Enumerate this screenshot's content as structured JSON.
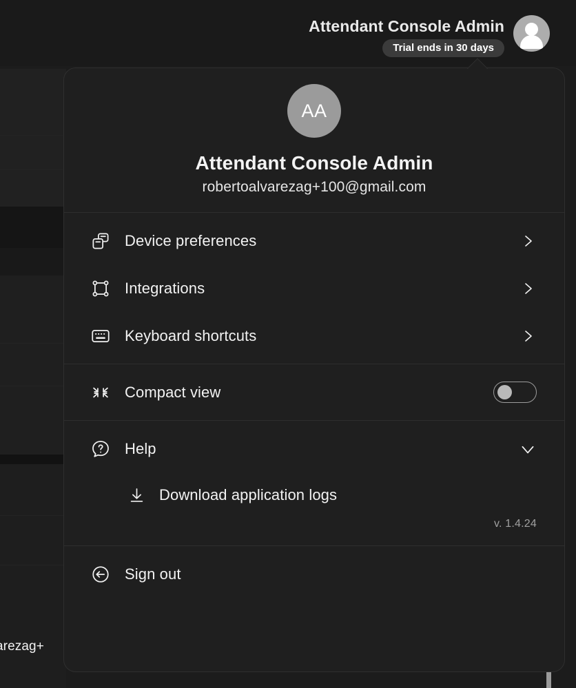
{
  "header": {
    "user_name": "Attendant Console Admin",
    "trial_badge": "Trial ends in 30 days",
    "avatar_icon": "person-avatar-icon"
  },
  "background": {
    "clipped_email_text": "arezag+"
  },
  "popup": {
    "profile": {
      "initials": "AA",
      "name": "Attendant Console Admin",
      "email": "robertoalvarezag+100@gmail.com"
    },
    "menu_items": [
      {
        "label": "Device preferences",
        "icon": "devices-icon",
        "chevron": "chevron-right-icon"
      },
      {
        "label": "Integrations",
        "icon": "integrations-nodes-icon",
        "chevron": "chevron-right-icon"
      },
      {
        "label": "Keyboard shortcuts",
        "icon": "keyboard-icon",
        "chevron": "chevron-right-icon"
      }
    ],
    "compact_view": {
      "label": "Compact view",
      "icon": "collapse-arrows-icon",
      "toggle_state": "off"
    },
    "help": {
      "label": "Help",
      "icon": "question-chat-icon",
      "chevron": "chevron-down-icon",
      "expanded": true,
      "download_logs_label": "Download application logs",
      "download_icon": "download-icon",
      "version": "v. 1.4.24"
    },
    "sign_out": {
      "label": "Sign out",
      "icon": "sign-out-icon"
    }
  },
  "colors": {
    "popup_bg": "#1f1f1f",
    "app_bg": "#1c1c1c",
    "divider": "#2e2e2e",
    "text_primary": "#f2f2f2",
    "text_muted": "#a0a0a0",
    "badge_bg": "#3b3b3b",
    "avatar_bg": "#9b9b9b"
  }
}
